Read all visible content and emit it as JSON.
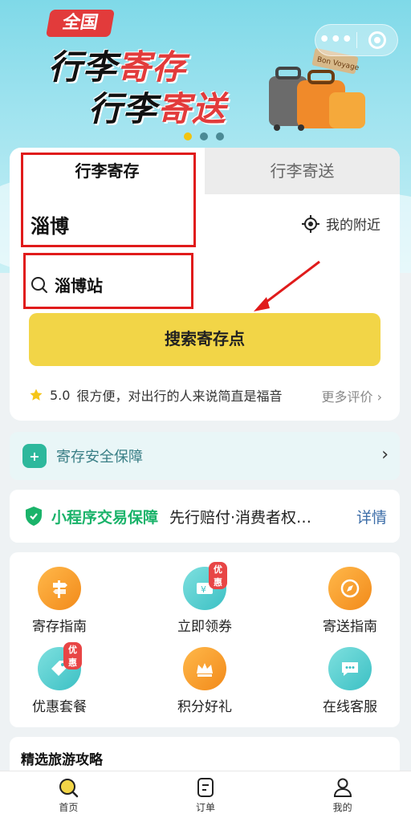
{
  "banner": {
    "badge": "全国",
    "headline1_black": "行李",
    "headline1_red": "寄存",
    "headline2_black": "行李",
    "headline2_red": "寄送",
    "capsule_more": "•••",
    "luggage_tag": "Bon Voyage",
    "pager": {
      "count": 3,
      "active_index": 0
    }
  },
  "tabs": [
    {
      "label": "行李寄存",
      "active": true
    },
    {
      "label": "行李寄送",
      "active": false
    }
  ],
  "search": {
    "city": "淄博",
    "nearby_label": "我的附近",
    "station": "淄博站",
    "button_label": "搜索寄存点"
  },
  "review": {
    "score": "5.0",
    "text": "很方便，对出行的人来说简直是福音",
    "more_label": "更多评价"
  },
  "safety": {
    "label": "寄存安全保障",
    "icon": "shield-plus-icon"
  },
  "trade": {
    "label": "小程序交易保障",
    "desc": "先行赔付·消费者权…",
    "detail_label": "详情"
  },
  "features": [
    {
      "label": "寄存指南",
      "icon": "signpost-icon",
      "color": "#f59b2a",
      "badge": ""
    },
    {
      "label": "立即领券",
      "icon": "coupon-icon",
      "color": "#3cc0c4",
      "badge": "优惠"
    },
    {
      "label": "寄送指南",
      "icon": "compass-icon",
      "color": "#f59b2a",
      "badge": ""
    },
    {
      "label": "优惠套餐",
      "icon": "tag-icon",
      "color": "#3cc0c4",
      "badge": "优惠"
    },
    {
      "label": "积分好礼",
      "icon": "crown-icon",
      "color": "#f59b2a",
      "badge": ""
    },
    {
      "label": "在线客服",
      "icon": "chat-bubble-icon",
      "color": "#3cc0c4",
      "badge": ""
    }
  ],
  "guide": {
    "title": "精选旅游攻略"
  },
  "bottom_nav": [
    {
      "label": "首页",
      "icon": "home-search-icon",
      "active": true
    },
    {
      "label": "订单",
      "icon": "order-icon",
      "active": false
    },
    {
      "label": "我的",
      "icon": "profile-icon",
      "active": false
    }
  ],
  "colors": {
    "accent_yellow": "#f2d547",
    "brand_red": "#e23b3b",
    "teal": "#3cc0c4",
    "orange": "#f59b2a",
    "green": "#1ab36a"
  }
}
